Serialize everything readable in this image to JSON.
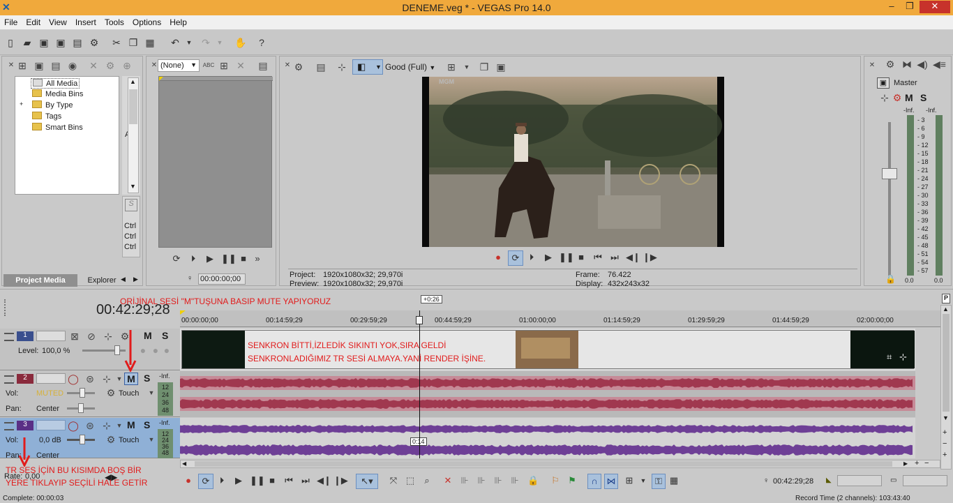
{
  "window": {
    "title": "DENEME.veg * - VEGAS Pro 14.0",
    "min": "–",
    "max": "❐",
    "close": "✕"
  },
  "menu": [
    "File",
    "Edit",
    "View",
    "Insert",
    "Tools",
    "Options",
    "Help"
  ],
  "project_media": {
    "tree": [
      "All Media",
      "Media Bins",
      "By Type",
      "Tags",
      "Smart Bins"
    ],
    "expander": "+",
    "tabs": [
      "Project Media",
      "Explorer"
    ],
    "side_letter": "A",
    "ctrl_labels": [
      "Ctrl",
      "Ctrl",
      "Ctrl"
    ]
  },
  "trimmer": {
    "dropdown": "(None)",
    "timecode": "00:00:00;00"
  },
  "preview": {
    "quality": "Good (Full)",
    "project_label": "Project:",
    "project_value": "1920x1080x32; 29,970i",
    "preview_label": "Preview:",
    "preview_value": "1920x1080x32; 29,970i",
    "frame_label": "Frame:",
    "frame_value": "76.422",
    "display_label": "Display:",
    "display_value": "432x243x32",
    "watermark": "MGM"
  },
  "master": {
    "label": "Master",
    "m": "M",
    "s": "S",
    "inf_left": "-Inf.",
    "inf_right": "-Inf.",
    "scale": [
      "3",
      "6",
      "9",
      "12",
      "15",
      "18",
      "21",
      "24",
      "27",
      "30",
      "33",
      "36",
      "39",
      "42",
      "45",
      "48",
      "51",
      "54",
      "57"
    ],
    "bottom_left": "0.0",
    "bottom_right": "0.0"
  },
  "timeline": {
    "timecode": "00:42:29;28",
    "offset_flag": "+0:26",
    "ruler": [
      "00:00:00;00",
      "00:14:59;29",
      "00:29:59;29",
      "00:44:59;29",
      "01:00:00;00",
      "01:14:59;29",
      "01:29:59;29",
      "01:44:59;29",
      "02:00:00;00"
    ],
    "cursor_flag": "0:14",
    "tracks": [
      {
        "num": "1",
        "m": "M",
        "s": "S",
        "level_label": "Level:",
        "level": "100,0 %"
      },
      {
        "num": "2",
        "m": "M",
        "s": "S",
        "vol_label": "Vol:",
        "vol": "MUTED",
        "pan_label": "Pan:",
        "pan": "Center",
        "mode": "Touch",
        "inf": "-Inf.",
        "meter": [
          "12",
          "24",
          "36",
          "48"
        ]
      },
      {
        "num": "3",
        "m": "M",
        "s": "S",
        "vol_label": "Vol:",
        "vol": "0,0 dB",
        "pan_label": "Pan:",
        "pan": "Center",
        "mode": "Touch",
        "inf": "-Inf.",
        "meter": [
          "12",
          "24",
          "36",
          "48"
        ]
      }
    ],
    "rate_label": "Rate:",
    "rate": "0,00",
    "bottom_timecode": "00:42:29;28",
    "complete": "Complete: 00:00:03",
    "record_time": "Record Time (2 channels): 103:43:40"
  },
  "annotations": {
    "top": "ORİJİNAL SESİ \"M\"TUŞUNA BASIP MUTE YAPIYORUZ",
    "clip_line1": "SENKRON BİTTİ,İZLEDİK SIKINTI YOK,SIRA GELDİ",
    "clip_line2": "SENKRONLADIĞIMIZ TR SESİ ALMAYA.YANİ RENDER İŞİNE.",
    "bottom_line1": "TR SES İÇİN BU KISIMDA BOŞ BİR",
    "bottom_line2": "YERE TIKLAYIP SEÇİLİ HALE GETİR"
  },
  "colors": {
    "titlebar": "#f0a93c",
    "audio2": "#a0384f",
    "audio3": "#6e3f96",
    "annotation": "#e11b1b"
  }
}
